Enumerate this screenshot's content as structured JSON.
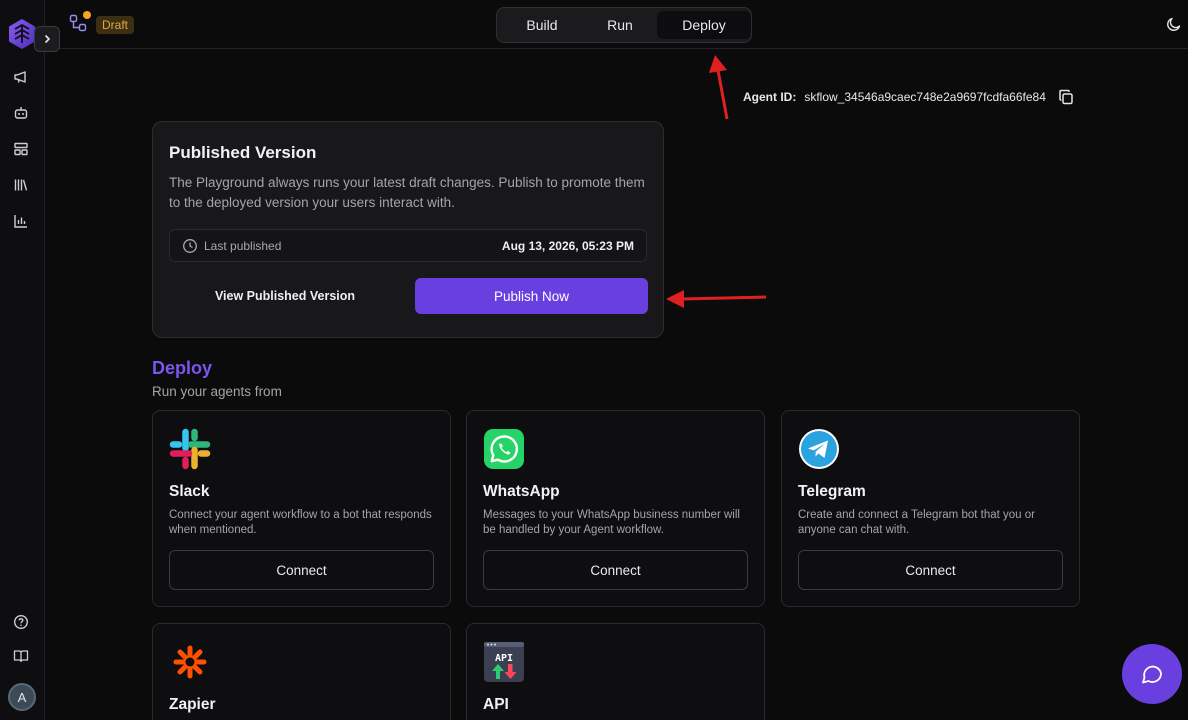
{
  "topbar": {
    "draft_badge": "Draft",
    "tabs": [
      {
        "label": "Build",
        "active": false
      },
      {
        "label": "Run",
        "active": false
      },
      {
        "label": "Deploy",
        "active": true
      }
    ]
  },
  "agent": {
    "id_label": "Agent ID:",
    "id_value": "skflow_34546a9caec748e2a9697fcdfa66fe84"
  },
  "published": {
    "title": "Published Version",
    "description": "The Playground always runs your latest draft changes. Publish to promote them to the deployed version your users interact with.",
    "last_published_label": "Last published",
    "last_published_value": "Aug 13, 2026, 05:23 PM",
    "view_button": "View Published Version",
    "publish_button": "Publish Now"
  },
  "deploy": {
    "title": "Deploy",
    "subtitle": "Run your agents from",
    "cards": [
      {
        "name": "Slack",
        "icon": "slack-icon",
        "description": "Connect your agent workflow to a bot that responds when mentioned.",
        "button": "Connect"
      },
      {
        "name": "WhatsApp",
        "icon": "whatsapp-icon",
        "description": "Messages to your WhatsApp business number will be handled by your Agent workflow.",
        "button": "Connect"
      },
      {
        "name": "Telegram",
        "icon": "telegram-icon",
        "description": "Create and connect a Telegram bot that you or anyone can chat with.",
        "button": "Connect"
      },
      {
        "name": "Zapier",
        "icon": "zapier-icon"
      },
      {
        "name": "API",
        "icon": "api-icon",
        "icon_text": "API"
      }
    ]
  },
  "user": {
    "avatar_initial": "A"
  },
  "colors": {
    "accent": "#6a3fe0",
    "draft_badge_text": "#e0a640",
    "annotation_arrow": "#e02020"
  }
}
